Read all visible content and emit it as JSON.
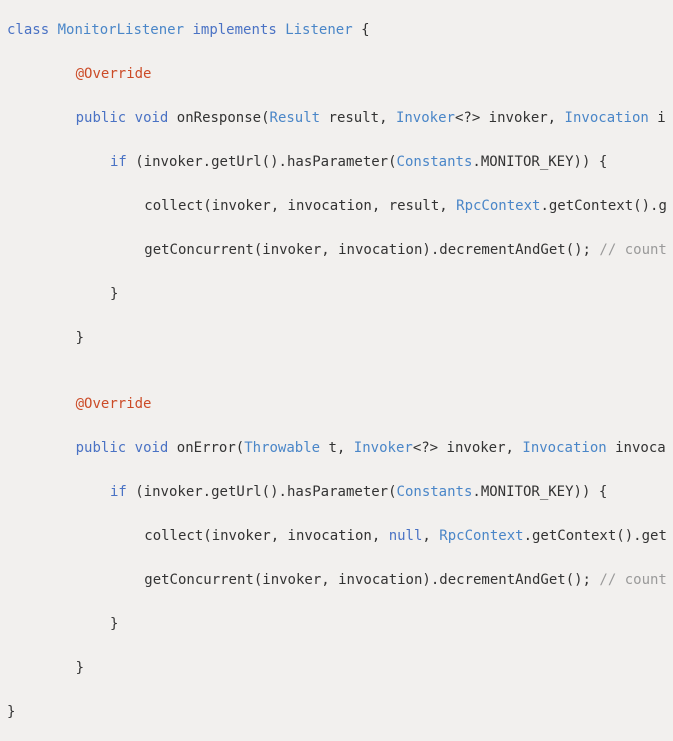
{
  "code": {
    "lines": [
      {
        "indent": 0,
        "tokens": [
          {
            "c": "kw",
            "t": "class"
          },
          {
            "c": "txt",
            "t": " "
          },
          {
            "c": "type",
            "t": "MonitorListener"
          },
          {
            "c": "txt",
            "t": " "
          },
          {
            "c": "kw",
            "t": "implements"
          },
          {
            "c": "txt",
            "t": " "
          },
          {
            "c": "type",
            "t": "Listener"
          },
          {
            "c": "txt",
            "t": " {"
          }
        ]
      },
      {
        "indent": 0,
        "tokens": []
      },
      {
        "indent": 8,
        "tokens": [
          {
            "c": "ann",
            "t": "@Override"
          }
        ]
      },
      {
        "indent": 0,
        "tokens": []
      },
      {
        "indent": 8,
        "tokens": [
          {
            "c": "kw",
            "t": "public"
          },
          {
            "c": "txt",
            "t": " "
          },
          {
            "c": "kw",
            "t": "void"
          },
          {
            "c": "txt",
            "t": " onResponse("
          },
          {
            "c": "type",
            "t": "Result"
          },
          {
            "c": "txt",
            "t": " result, "
          },
          {
            "c": "type",
            "t": "Invoker"
          },
          {
            "c": "txt",
            "t": "<?> invoker, "
          },
          {
            "c": "type",
            "t": "Invocation"
          },
          {
            "c": "txt",
            "t": " i"
          }
        ]
      },
      {
        "indent": 0,
        "tokens": []
      },
      {
        "indent": 12,
        "tokens": [
          {
            "c": "kw",
            "t": "if"
          },
          {
            "c": "txt",
            "t": " (invoker.getUrl().hasParameter("
          },
          {
            "c": "type",
            "t": "Constants"
          },
          {
            "c": "txt",
            "t": ".MONITOR_KEY)) {"
          }
        ]
      },
      {
        "indent": 0,
        "tokens": []
      },
      {
        "indent": 16,
        "tokens": [
          {
            "c": "txt",
            "t": "collect(invoker, invocation, result, "
          },
          {
            "c": "type",
            "t": "RpcContext"
          },
          {
            "c": "txt",
            "t": ".getContext().g"
          }
        ]
      },
      {
        "indent": 0,
        "tokens": []
      },
      {
        "indent": 16,
        "tokens": [
          {
            "c": "txt",
            "t": "getConcurrent(invoker, invocation).decrementAndGet(); "
          },
          {
            "c": "cmt",
            "t": "// count"
          }
        ]
      },
      {
        "indent": 0,
        "tokens": []
      },
      {
        "indent": 12,
        "tokens": [
          {
            "c": "txt",
            "t": "}"
          }
        ]
      },
      {
        "indent": 0,
        "tokens": []
      },
      {
        "indent": 8,
        "tokens": [
          {
            "c": "txt",
            "t": "}"
          }
        ]
      },
      {
        "indent": 0,
        "tokens": []
      },
      {
        "indent": 0,
        "tokens": []
      },
      {
        "indent": 8,
        "tokens": [
          {
            "c": "ann",
            "t": "@Override"
          }
        ]
      },
      {
        "indent": 0,
        "tokens": []
      },
      {
        "indent": 8,
        "tokens": [
          {
            "c": "kw",
            "t": "public"
          },
          {
            "c": "txt",
            "t": " "
          },
          {
            "c": "kw",
            "t": "void"
          },
          {
            "c": "txt",
            "t": " onError("
          },
          {
            "c": "type",
            "t": "Throwable"
          },
          {
            "c": "txt",
            "t": " t, "
          },
          {
            "c": "type",
            "t": "Invoker"
          },
          {
            "c": "txt",
            "t": "<?> invoker, "
          },
          {
            "c": "type",
            "t": "Invocation"
          },
          {
            "c": "txt",
            "t": " invoca"
          }
        ]
      },
      {
        "indent": 0,
        "tokens": []
      },
      {
        "indent": 12,
        "tokens": [
          {
            "c": "kw",
            "t": "if"
          },
          {
            "c": "txt",
            "t": " (invoker.getUrl().hasParameter("
          },
          {
            "c": "type",
            "t": "Constants"
          },
          {
            "c": "txt",
            "t": ".MONITOR_KEY)) {"
          }
        ]
      },
      {
        "indent": 0,
        "tokens": []
      },
      {
        "indent": 16,
        "tokens": [
          {
            "c": "txt",
            "t": "collect(invoker, invocation, "
          },
          {
            "c": "kw",
            "t": "null"
          },
          {
            "c": "txt",
            "t": ", "
          },
          {
            "c": "type",
            "t": "RpcContext"
          },
          {
            "c": "txt",
            "t": ".getContext().get"
          }
        ]
      },
      {
        "indent": 0,
        "tokens": []
      },
      {
        "indent": 16,
        "tokens": [
          {
            "c": "txt",
            "t": "getConcurrent(invoker, invocation).decrementAndGet(); "
          },
          {
            "c": "cmt",
            "t": "// count"
          }
        ]
      },
      {
        "indent": 0,
        "tokens": []
      },
      {
        "indent": 12,
        "tokens": [
          {
            "c": "txt",
            "t": "}"
          }
        ]
      },
      {
        "indent": 0,
        "tokens": []
      },
      {
        "indent": 8,
        "tokens": [
          {
            "c": "txt",
            "t": "}"
          }
        ]
      },
      {
        "indent": 0,
        "tokens": []
      },
      {
        "indent": 0,
        "tokens": [
          {
            "c": "txt",
            "t": "}"
          }
        ]
      }
    ],
    "colors": {
      "background": "#f2f0ee",
      "keyword": "#4a72c4",
      "type": "#4a86c8",
      "annotation": "#cc4b27",
      "comment": "#9a9a9a",
      "text": "#333333"
    }
  }
}
